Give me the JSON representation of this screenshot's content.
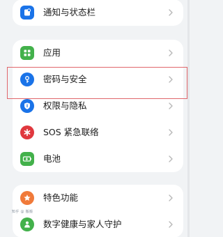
{
  "colors": {
    "background": "#f1f3f5",
    "card": "#ffffff",
    "highlight_border": "#e0666b",
    "icon_blue": "#1a73e8",
    "icon_green": "#43b14b",
    "icon_red": "#e0383e",
    "icon_orange": "#f07a3a"
  },
  "groups": [
    {
      "items": [
        {
          "label": "通知与状态栏",
          "icon": "notification-icon"
        }
      ]
    },
    {
      "items": [
        {
          "label": "应用",
          "icon": "apps-grid-icon"
        },
        {
          "label": "密码与安全",
          "icon": "key-icon"
        },
        {
          "label": "权限与隐私",
          "icon": "shield-icon"
        },
        {
          "label": "SOS 紧急联络",
          "icon": "sos-asterisk-icon"
        },
        {
          "label": "电池",
          "icon": "battery-icon"
        }
      ]
    },
    {
      "items": [
        {
          "label": "特色功能",
          "icon": "star-icon"
        },
        {
          "label": "数字健康与家人守护",
          "icon": "person-heart-icon"
        }
      ]
    }
  ],
  "watermark_text": "知乎 @ 搬搬"
}
